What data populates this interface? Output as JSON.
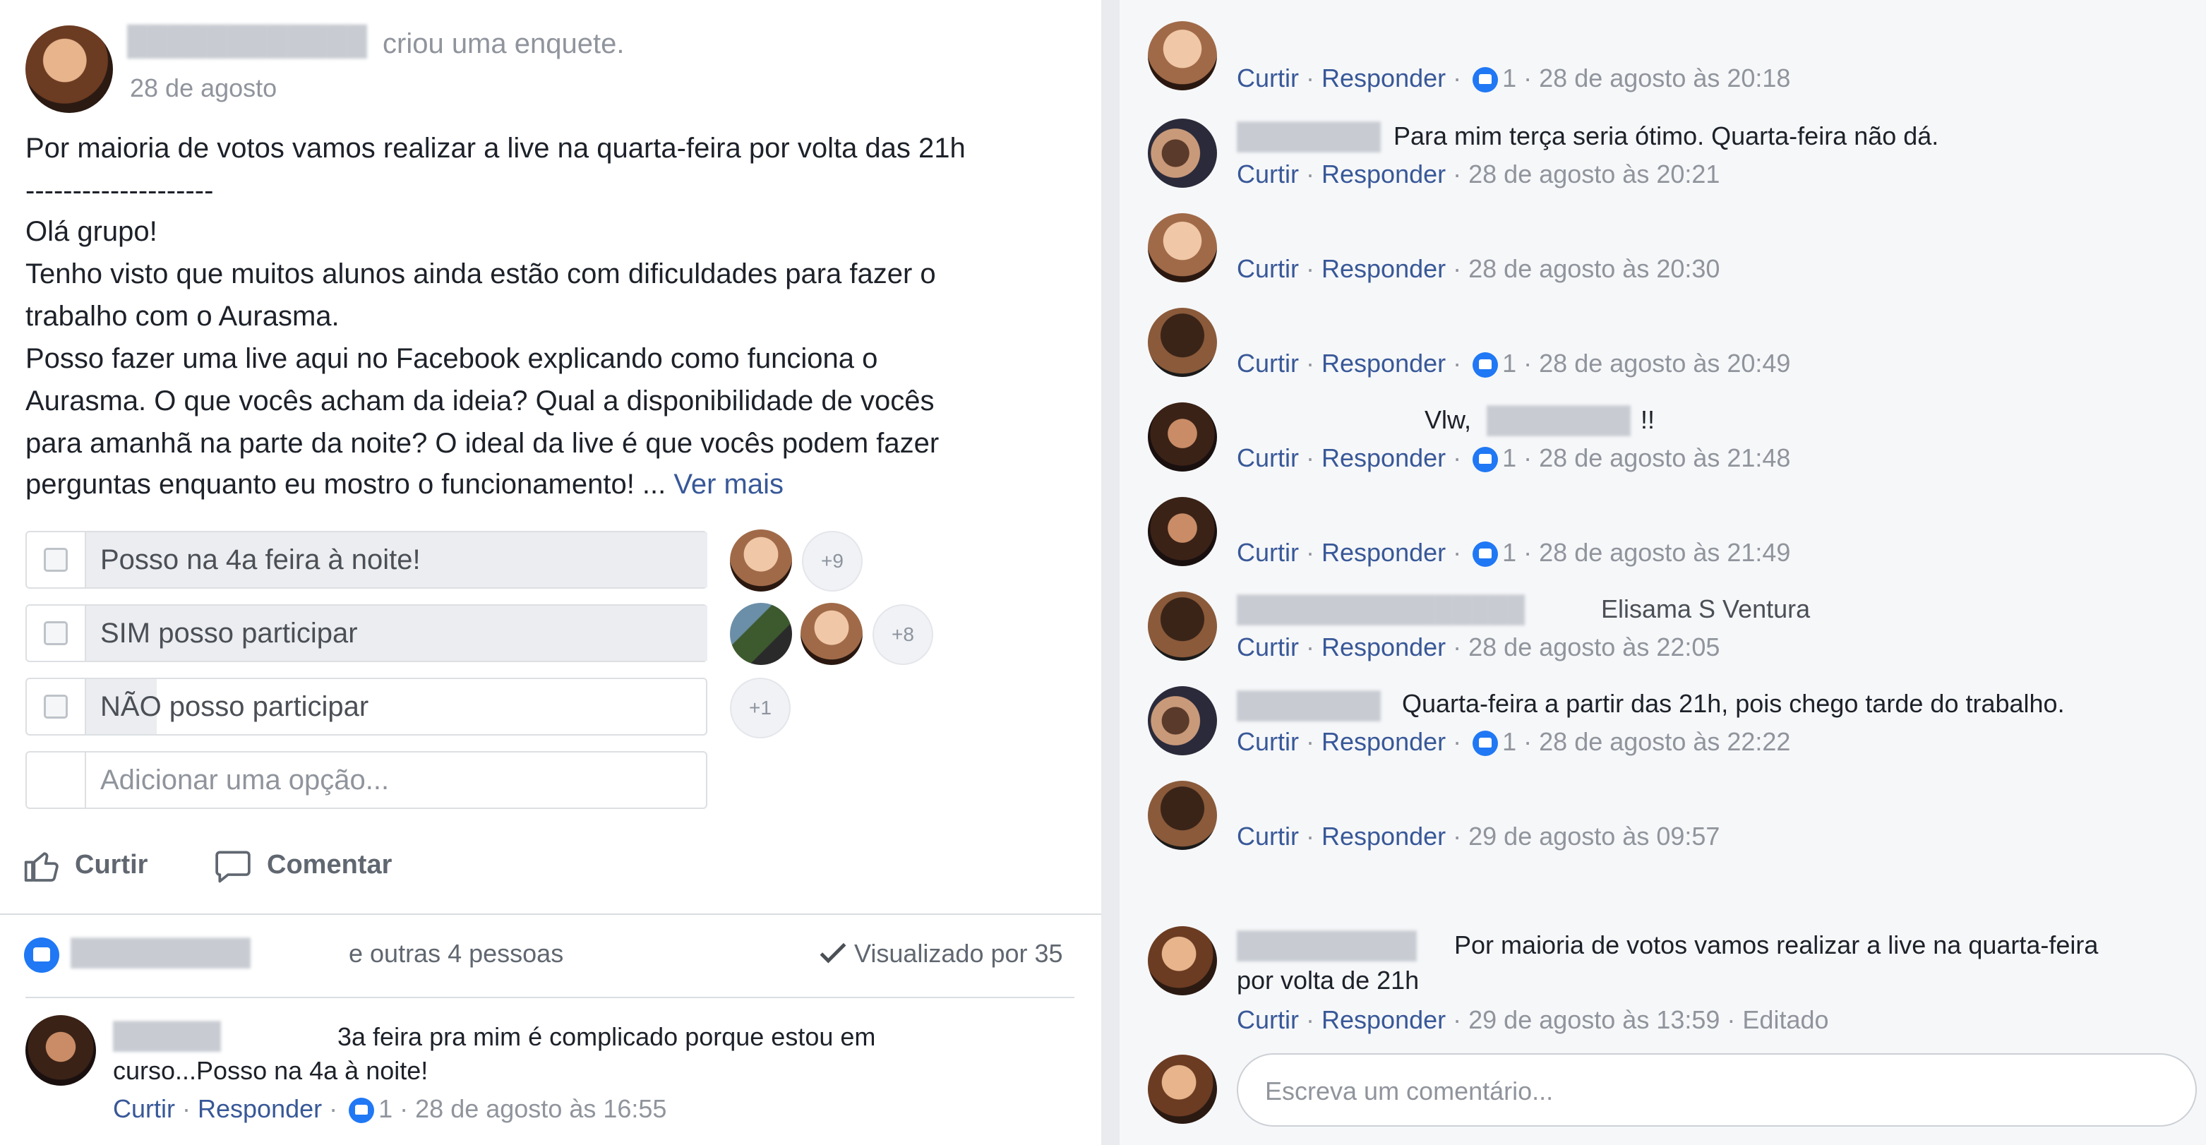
{
  "post": {
    "author_action": "criou uma enquete.",
    "date": "28 de agosto",
    "lines": [
      "Por maioria de votos vamos realizar a live na quarta-feira por volta das 21h",
      "--------------------",
      "Olá grupo!",
      "Tenho visto que muitos alunos ainda estão com dificuldades para fazer o",
      "trabalho com o Aurasma.",
      "Posso fazer uma live aqui no Facebook explicando como funciona o",
      "Aurasma. O que vocês acham da ideia? Qual a disponibilidade de vocês",
      "para amanhã na parte da noite? O ideal da live é que vocês podem fazer",
      "perguntas enquanto eu mostro o funcionamento! ..."
    ],
    "see_more": "Ver mais"
  },
  "poll": {
    "options": [
      {
        "label": "Posso na 4a feira à noite!",
        "extra": "+9"
      },
      {
        "label": "SIM posso participar",
        "extra": "+8"
      },
      {
        "label": "NÃO posso participar",
        "extra": "+1"
      }
    ],
    "add_placeholder": "Adicionar uma opção..."
  },
  "actions": {
    "like": "Curtir",
    "comment": "Comentar"
  },
  "reactions": {
    "summary": "e outras 4 pessoas",
    "seen": "Visualizado por 35"
  },
  "left_comment": {
    "text_line1": "3a feira pra mim é complicado porque estou em",
    "text_line2": "curso...Posso na 4a à noite!",
    "like": "Curtir",
    "reply": "Responder",
    "likes": "1",
    "time": "28 de agosto às 16:55"
  },
  "comments": [
    {
      "text": "",
      "time": "28 de agosto às 20:18",
      "likes": "1"
    },
    {
      "text": "Para mim terça seria ótimo. Quarta-feira não dá.",
      "time": "28 de agosto às 20:21",
      "likes": ""
    },
    {
      "text": "",
      "time": "28 de agosto às 20:30",
      "likes": ""
    },
    {
      "text": "",
      "time": "28 de agosto às 20:49",
      "likes": "1"
    },
    {
      "text": "Vlw,",
      "text_b": "!!",
      "time": "28 de agosto às 21:48",
      "likes": "1"
    },
    {
      "text": "",
      "time": "28 de agosto às 21:49",
      "likes": "1"
    },
    {
      "text": "Elisama S Ventura",
      "time": "28 de agosto às 22:05",
      "likes": ""
    },
    {
      "text": "Quarta-feira a partir das 21h, pois chego tarde do trabalho.",
      "time": "28 de agosto às 22:22",
      "likes": "1"
    },
    {
      "text": "",
      "time": "29 de agosto às 09:57",
      "likes": ""
    }
  ],
  "last_comment": {
    "line1": "Por maioria de votos vamos realizar a live na quarta-feira",
    "line2": "por volta de 21h",
    "time": "29 de agosto às 13:59",
    "edited": "Editado"
  },
  "labels": {
    "like": "Curtir",
    "reply": "Responder",
    "sep": " · "
  },
  "input": {
    "placeholder": "Escreva um comentário..."
  },
  "colors": {
    "link": "#385898",
    "muted": "#90949c",
    "like_blue": "#2078f4"
  }
}
